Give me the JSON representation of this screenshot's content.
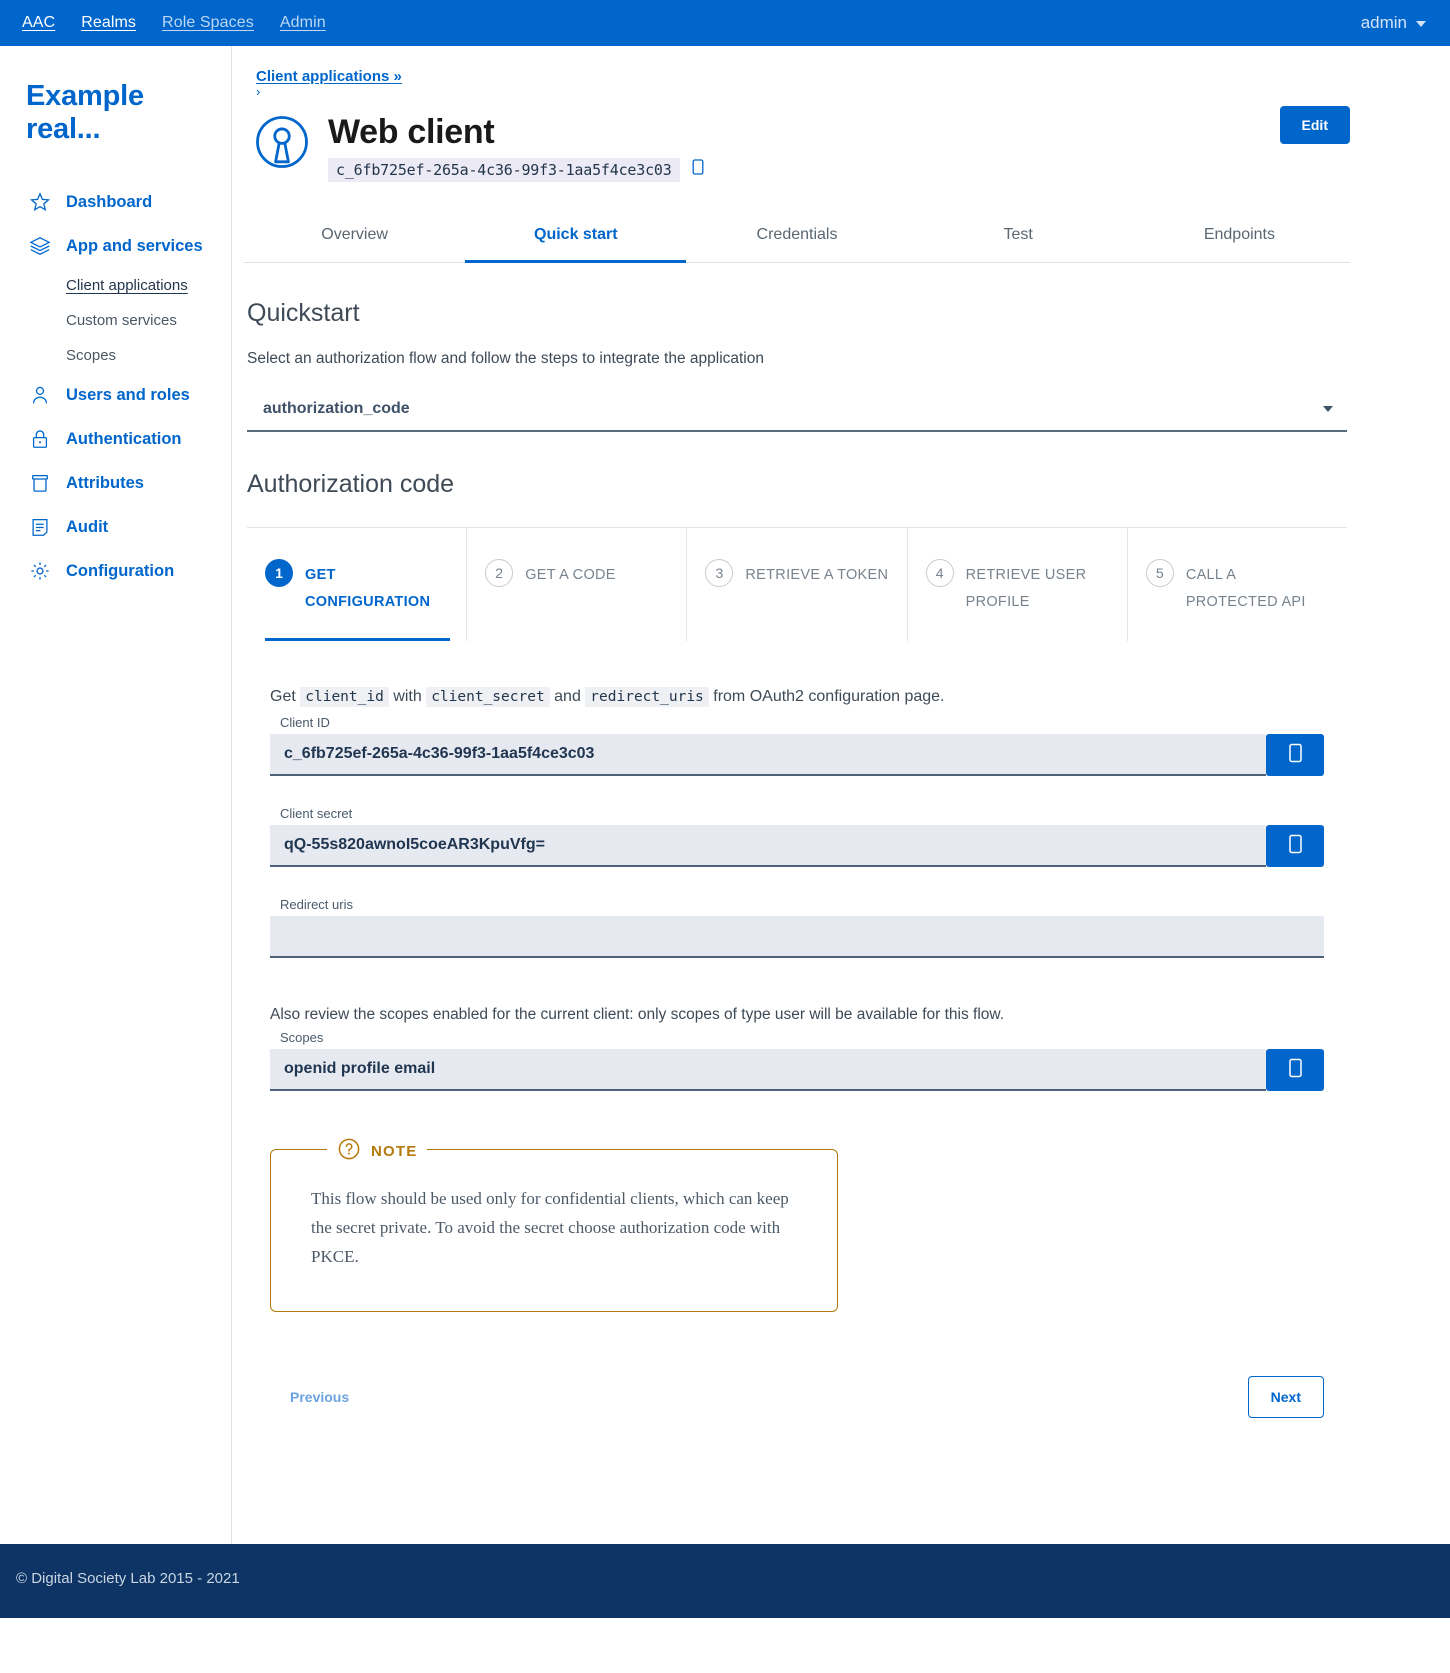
{
  "topnav": {
    "links": [
      {
        "label": "AAC",
        "dim": false
      },
      {
        "label": "Realms",
        "dim": false
      },
      {
        "label": "Role Spaces",
        "dim": true
      },
      {
        "label": "Admin",
        "dim": true
      }
    ],
    "user": "admin"
  },
  "sidebar": {
    "realm_title": "Example real...",
    "items": [
      {
        "label": "Dashboard",
        "icon": "star-icon"
      },
      {
        "label": "App and services",
        "icon": "layers-icon"
      },
      {
        "label": "Users and roles",
        "icon": "user-icon"
      },
      {
        "label": "Authentication",
        "icon": "lock-icon"
      },
      {
        "label": "Attributes",
        "icon": "archive-icon"
      },
      {
        "label": "Audit",
        "icon": "document-icon"
      },
      {
        "label": "Configuration",
        "icon": "gear-icon"
      }
    ],
    "subitems": [
      {
        "label": "Client applications",
        "active": true
      },
      {
        "label": "Custom services",
        "active": false
      },
      {
        "label": "Scopes",
        "active": false
      }
    ]
  },
  "header": {
    "breadcrumb": "Client applications »",
    "breadcrumb_chevron": "›",
    "edit_label": "Edit",
    "client_name": "Web client",
    "client_id": "c_6fb725ef-265a-4c36-99f3-1aa5f4ce3c03"
  },
  "tabs": [
    {
      "label": "Overview",
      "active": false
    },
    {
      "label": "Quick start",
      "active": true
    },
    {
      "label": "Credentials",
      "active": false
    },
    {
      "label": "Test",
      "active": false
    },
    {
      "label": "Endpoints",
      "active": false
    }
  ],
  "quickstart": {
    "title": "Quickstart",
    "description": "Select an authorization flow and follow the steps to integrate the application",
    "selected_flow": "authorization_code",
    "flow_options": [
      "authorization_code"
    ],
    "flow_title": "Authorization code"
  },
  "steps": [
    {
      "num": "1",
      "label": "GET CONFIGURATION",
      "active": true
    },
    {
      "num": "2",
      "label": "GET A CODE",
      "active": false
    },
    {
      "num": "3",
      "label": "RETRIEVE A TOKEN",
      "active": false
    },
    {
      "num": "4",
      "label": "RETRIEVE USER PROFILE",
      "active": false
    },
    {
      "num": "5",
      "label": "CALL A PROTECTED API",
      "active": false
    }
  ],
  "panel": {
    "intro": {
      "p1": "Get",
      "code1": "client_id",
      "p2": "with",
      "code2": "client_secret",
      "p3": "and",
      "code3": "redirect_uris",
      "p4": "from OAuth2 configuration page."
    },
    "fields": [
      {
        "label": "Client ID",
        "value": "c_6fb725ef-265a-4c36-99f3-1aa5f4ce3c03",
        "placeholder": "",
        "copy": true
      },
      {
        "label": "Client secret",
        "value": "qQ-55s820awnoI5coeAR3KpuVfg=",
        "placeholder": "",
        "copy": true
      },
      {
        "label": "Redirect uris",
        "value": "",
        "placeholder": "",
        "copy": false
      }
    ],
    "scopes_text": "Also review the scopes enabled for the current client: only scopes of type user will be available for this flow.",
    "scopes_field": {
      "label": "Scopes",
      "value": "openid profile email",
      "placeholder": ""
    },
    "note": {
      "legend": "NOTE",
      "icon": "question-circle-icon",
      "body": "This flow should be used only for confidential clients, which can keep the secret private. To avoid the secret choose authorization code with PKCE."
    },
    "previous_label": "Previous",
    "next_label": "Next"
  },
  "footer": {
    "copyright": "© Digital Society Lab 2015 - 2021"
  },
  "colors": {
    "brand": "#0066cc",
    "footer_bg": "#0d3464",
    "note_border": "#b5790b",
    "field_bg": "#e6e9f0"
  }
}
